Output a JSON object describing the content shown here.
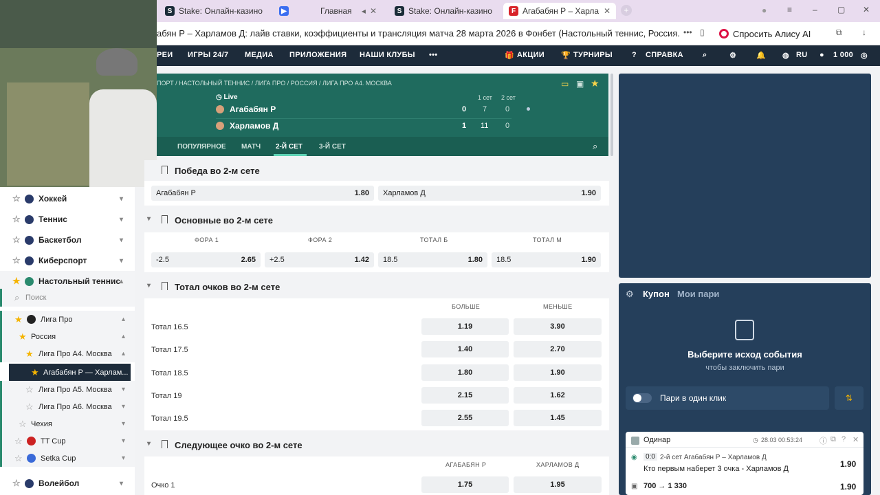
{
  "tabs": [
    {
      "label": "Stake: Онлайн-казино и с",
      "icon": "stake-icon"
    },
    {
      "label": "Главная",
      "icon": "play-icon"
    },
    {
      "label": "Stake: Онлайн-казино и с",
      "icon": "stake-icon"
    },
    {
      "label": "Агабабян Р – Харламо",
      "icon": "fonbet-icon",
      "active": true
    }
  ],
  "address": {
    "title": "абян Р – Харламов Д: лайв ставки, коэффициенты и трансляция матча 28 марта 2026 в Фонбет (Настольный теннис, Россия....",
    "alice": "Спросить Алису AI"
  },
  "nav": {
    "items": [
      "РЕИ",
      "ИГРЫ 24/7",
      "МЕДИА",
      "ПРИЛОЖЕНИЯ",
      "НАШИ КЛУБЫ",
      "•••"
    ],
    "promo": "АКЦИИ",
    "tournaments": "ТУРНИРЫ",
    "help": "СПРАВКА",
    "lang": "RU",
    "balance": "1 000"
  },
  "sidebar": {
    "sports": [
      {
        "label": "Хоккей"
      },
      {
        "label": "Теннис"
      },
      {
        "label": "Баскетбол"
      },
      {
        "label": "Киберспорт"
      },
      {
        "label": "Настольный теннис"
      }
    ],
    "search": "Поиск",
    "tree": [
      "Лига Про",
      "Россия",
      "Лига Про А4. Москва",
      "Агабабян Р — Харлам...",
      "Лига Про А5. Москва",
      "Лига Про А6. Москва",
      "Чехия",
      "TT Cup",
      "Setka Cup"
    ],
    "bottom": "Волейбол"
  },
  "match": {
    "breadcrumb": "ПОРТ / НАСТОЛЬНЫЙ ТЕННИС / ЛИГА ПРО / РОССИЯ / ЛИГА ПРО А4. МОСКВА",
    "live": "Live",
    "set1": "1 сет",
    "set2": "2 сет",
    "p1": {
      "name": "Агабабян Р",
      "sets": "0",
      "s1": "7",
      "s2": "0"
    },
    "p2": {
      "name": "Харламов Д",
      "sets": "1",
      "s1": "11",
      "s2": "0"
    },
    "tabs": [
      "ПОПУЛЯРНОЕ",
      "МАТЧ",
      "2-Й СЕТ",
      "3-Й СЕТ"
    ]
  },
  "markets": {
    "win": {
      "title": "Победа во 2-м сете",
      "p1": "Агабабян Р",
      "o1": "1.80",
      "p2": "Харламов Д",
      "o2": "1.90"
    },
    "main": {
      "title": "Основные во 2-м сете",
      "cols": [
        "ФОРА 1",
        "ФОРА 2",
        "ТОТАЛ Б",
        "ТОТАЛ М"
      ],
      "cells": [
        [
          "-2.5",
          "2.65"
        ],
        [
          "+2.5",
          "1.42"
        ],
        [
          "18.5",
          "1.80"
        ],
        [
          "18.5",
          "1.90"
        ]
      ]
    },
    "total": {
      "title": "Тотал очков во 2-м сете",
      "over": "БОЛЬШЕ",
      "under": "МЕНЬШЕ",
      "rows": [
        [
          "Тотал 16.5",
          "1.19",
          "3.90"
        ],
        [
          "Тотал 17.5",
          "1.40",
          "2.70"
        ],
        [
          "Тотал 18.5",
          "1.80",
          "1.90"
        ],
        [
          "Тотал 19",
          "2.15",
          "1.62"
        ],
        [
          "Тотал 19.5",
          "2.55",
          "1.45"
        ]
      ]
    },
    "next": {
      "title": "Следующее очко во 2-м сете",
      "c1": "АГАБАБЯН Р",
      "c2": "ХАРЛАМОВ Д",
      "rows": [
        [
          "Очко 1",
          "1.75",
          "1.95"
        ]
      ]
    }
  },
  "coupon": {
    "tab1": "Купон",
    "tab2": "Мои пари",
    "empty_title": "Выберите исход события",
    "empty_sub": "чтобы заключить пари",
    "oneclick": "Пари в один клик",
    "bet": {
      "type": "Одинар",
      "time": "28.03  00:53:24",
      "score": "0:0",
      "event": "2-й сет Агабабян Р – Харламов Д",
      "market": "Кто первым наберет 3 очка - Харламов Д",
      "odd": "1.90",
      "stake": "700 → 1 330",
      "odd2": "1.90"
    }
  }
}
